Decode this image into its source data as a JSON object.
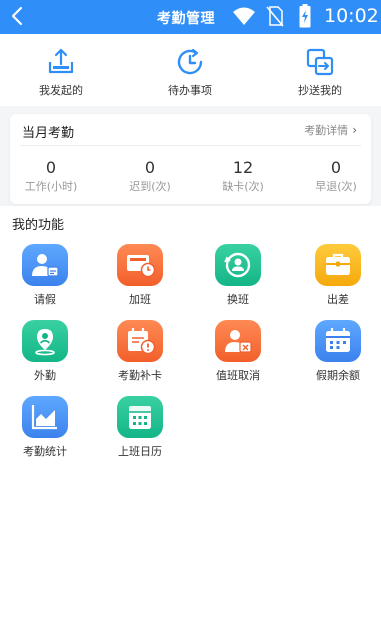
{
  "status_bar": {
    "title": "考勤管理",
    "time": "10:02",
    "icons": [
      "back-arrow-icon",
      "wifi-icon",
      "no-sim-icon",
      "battery-charging-icon"
    ],
    "accent_color": "#2f8ef7"
  },
  "top_nav": {
    "items": [
      {
        "label": "我发起的",
        "icon": "upload-tray-icon"
      },
      {
        "label": "待办事项",
        "icon": "clock-icon"
      },
      {
        "label": "抄送我的",
        "icon": "copy-send-icon"
      }
    ]
  },
  "month_card": {
    "title": "当月考勤",
    "link_label": "考勤详情",
    "link_icon": "chevron-right-icon",
    "stats": [
      {
        "value": "0",
        "caption": "工作(小时)"
      },
      {
        "value": "0",
        "caption": "迟到(次)"
      },
      {
        "value": "12",
        "caption": "缺卡(次)"
      },
      {
        "value": "0",
        "caption": "早退(次)"
      }
    ]
  },
  "features": {
    "title": "我的功能",
    "items": [
      {
        "label": "请假",
        "icon": "person-calendar-icon",
        "color": "#3b82ee"
      },
      {
        "label": "加班",
        "icon": "monitor-clock-icon",
        "color": "#f25f2b"
      },
      {
        "label": "换班",
        "icon": "swap-person-icon",
        "color": "#14b587"
      },
      {
        "label": "出差",
        "icon": "briefcase-icon",
        "color": "#f5a90c"
      },
      {
        "label": "外勤",
        "icon": "location-pin-icon",
        "color": "#14b587"
      },
      {
        "label": "考勤补卡",
        "icon": "calendar-alert-icon",
        "color": "#f25f2b"
      },
      {
        "label": "值班取消",
        "icon": "person-cancel-icon",
        "color": "#f25f2b"
      },
      {
        "label": "假期余额",
        "icon": "calendar-grid-icon",
        "color": "#3b82ee"
      },
      {
        "label": "考勤统计",
        "icon": "area-chart-icon",
        "color": "#3b82ee"
      },
      {
        "label": "上班日历",
        "icon": "calendar-icon",
        "color": "#14b587"
      }
    ]
  }
}
